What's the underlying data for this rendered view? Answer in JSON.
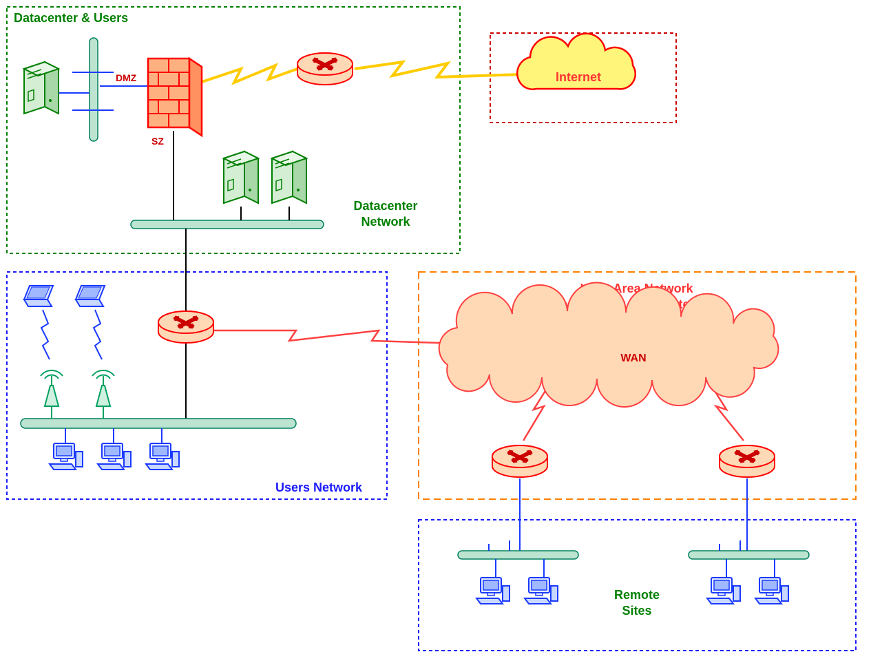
{
  "zones": {
    "datacenter_users": {
      "label": "Datacenter & Users"
    },
    "datacenter_network": {
      "label1": "Datacenter",
      "label2": "Network"
    },
    "users_network": {
      "label": "Users Network"
    },
    "wan_zone": {
      "line1": "Wide Area Network",
      "line2": "Connectivity to Remote Sites"
    },
    "remote_sites": {
      "label1": "Remote",
      "label2": "Sites"
    }
  },
  "internet": {
    "label": "Internet"
  },
  "wan": {
    "label": "WAN"
  },
  "firewall": {
    "dmz": "DMZ",
    "sz": "SZ"
  }
}
